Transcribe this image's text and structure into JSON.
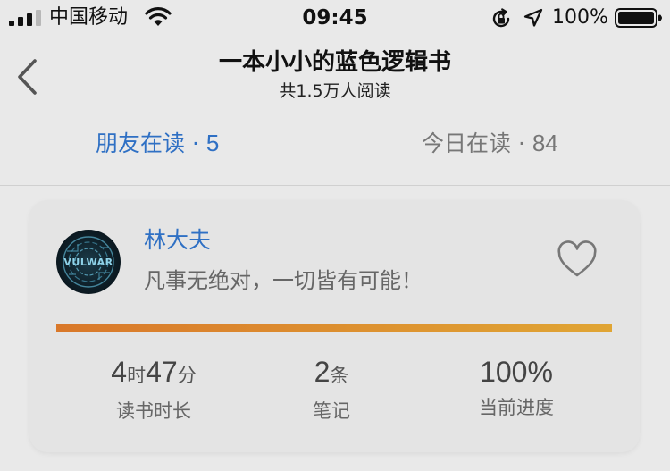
{
  "status_bar": {
    "carrier": "中国移动",
    "time": "09:45",
    "battery_percent": "100%",
    "battery_level": 1.0,
    "icons": [
      "signal-icon",
      "wifi-icon",
      "orientation-lock-icon",
      "location-icon",
      "battery-icon"
    ]
  },
  "header": {
    "back_icon": "chevron-left-icon",
    "title": "一本小小的蓝色逻辑书",
    "subtitle": "共1.5万人阅读"
  },
  "tabs": [
    {
      "label": "朋友在读 · ",
      "count": "5",
      "active": true
    },
    {
      "label": "今日在读 · ",
      "count": "84",
      "active": false
    }
  ],
  "card": {
    "user": {
      "name": "林大夫",
      "bio": "凡事无绝对，一切皆有可能！"
    },
    "like_icon": "heart-outline-icon",
    "progress": 1.0,
    "stats": {
      "time": {
        "hours": "4",
        "hours_unit": "时",
        "minutes": "47",
        "minutes_unit": "分",
        "label": "读书时长"
      },
      "notes": {
        "value": "2",
        "unit": "条",
        "label": "笔记"
      },
      "progress": {
        "value": "100%",
        "label": "当前进度"
      }
    }
  },
  "colors": {
    "accent_blue": "#2f70c4",
    "progress_start": "#d9782a",
    "progress_end": "#e0a534",
    "background": "#e9e9e9",
    "card": "#e4e4e4"
  }
}
